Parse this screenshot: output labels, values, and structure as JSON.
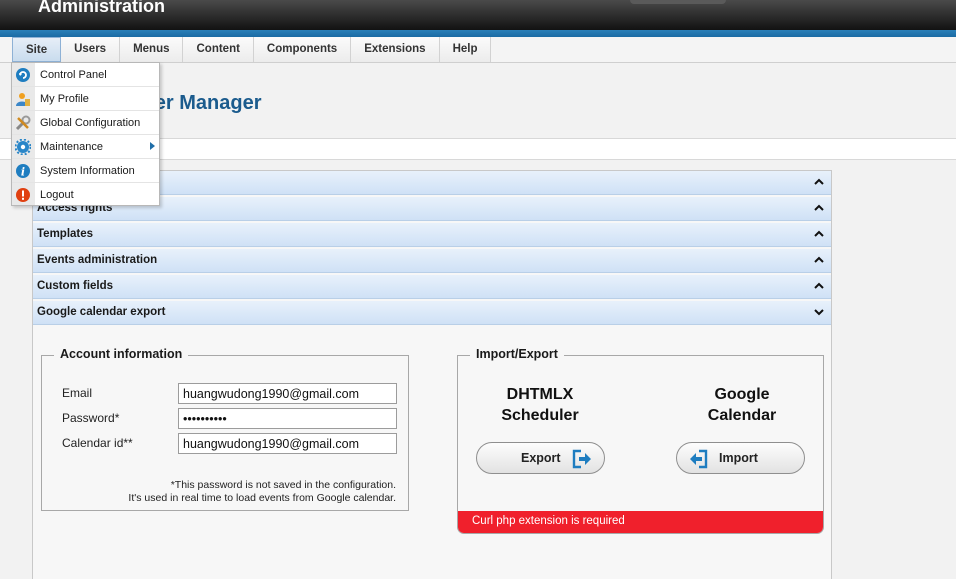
{
  "header": {
    "title": "Administration"
  },
  "menubar": {
    "items": [
      "Site",
      "Users",
      "Menus",
      "Content",
      "Components",
      "Extensions",
      "Help"
    ]
  },
  "site_menu": {
    "items": [
      {
        "label": "Control Panel",
        "icon": "control-panel-icon"
      },
      {
        "label": "My Profile",
        "icon": "profile-icon"
      },
      {
        "label": "Global Configuration",
        "icon": "tools-icon"
      },
      {
        "label": "Maintenance",
        "icon": "gear-icon",
        "has_submenu": true
      },
      {
        "label": "System Information",
        "icon": "info-icon"
      },
      {
        "label": "Logout",
        "icon": "logout-icon"
      }
    ]
  },
  "page": {
    "title_visible": "uler Manager"
  },
  "sections": [
    {
      "label": "",
      "state": "collapsed"
    },
    {
      "label": "Access rights",
      "state": "collapsed"
    },
    {
      "label": "Templates",
      "state": "collapsed"
    },
    {
      "label": "Events administration",
      "state": "collapsed"
    },
    {
      "label": "Custom fields",
      "state": "collapsed"
    },
    {
      "label": "Google calendar export",
      "state": "expanded"
    }
  ],
  "account": {
    "legend": "Account information",
    "email_label": "Email",
    "email_value": "huangwudong1990@gmail.com",
    "password_label": "Password*",
    "password_value": "••••••••••",
    "calendar_label": "Calendar id**",
    "calendar_value": "huangwudong1990@gmail.com",
    "note_line1": "*This password is not saved in the configuration.",
    "note_line2": "It's used in real time to load events from Google calendar."
  },
  "import_export": {
    "legend": "Import/Export",
    "left_title_1": "DHTMLX",
    "left_title_2": "Scheduler",
    "right_title_1": "Google",
    "right_title_2": "Calendar",
    "export_label": "Export",
    "import_label": "Import",
    "error": "Curl php extension is required"
  },
  "colors": {
    "accent": "#1b5b8d",
    "section_bg": "#cfe1f6",
    "error": "#f0202c",
    "header": "#121212"
  }
}
